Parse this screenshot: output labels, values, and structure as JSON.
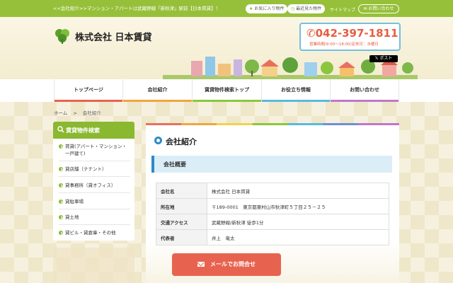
{
  "topbar": {
    "tagline": "<<会社紹介>>マンション・アパートは武蔵野線「新秋津」駅前【日本賃貸】！",
    "favorites": "お気に入り物件",
    "recent": "最近見た物件",
    "sitemap": "サイトマップ",
    "contact": "お問い合わせ"
  },
  "header": {
    "company": "株式会社 日本賃貸",
    "phone": "042-397-1811",
    "hours": "営業時間/9:00〜18:00/定休日：水曜日",
    "xpost": "ポスト"
  },
  "nav": {
    "items": [
      "トップページ",
      "会社紹介",
      "賃貸物件検索トップ",
      "お役立ち情報",
      "お問い合わせ"
    ],
    "colors": [
      "#e8634f",
      "#f0a640",
      "#8cc63f",
      "#59b9e0",
      "#c077c9"
    ]
  },
  "breadcrumb": {
    "home": "ホーム",
    "sep": ">",
    "current": "会社紹介"
  },
  "sidebar": {
    "title": "賃貸物件検索",
    "items": [
      "賃貸(アパート・マンション・一戸建て)",
      "貸店舗（テナント）",
      "貸事務所（貸オフィス）",
      "貸駐車場",
      "貸土地",
      "貸ビル・貸倉庫・その他"
    ]
  },
  "main": {
    "title": "会社紹介",
    "subtitle": "会社概要",
    "rows": [
      {
        "label": "会社名",
        "value": "株式会社 日本賃貸"
      },
      {
        "label": "所在地",
        "value": "〒189-0001　東京都東村山市秋津町５丁目２５－２５"
      },
      {
        "label": "交通アクセス",
        "value": "武蔵野線/新秋津 徒歩1分"
      },
      {
        "label": "代表者",
        "value": "井上　竜太"
      }
    ]
  },
  "cta": {
    "mail": "メールでお問合せ"
  },
  "colors": {
    "brand_green": "#8ab830",
    "accent_orange": "#e8634f",
    "accent_blue": "#2d8ac8"
  }
}
